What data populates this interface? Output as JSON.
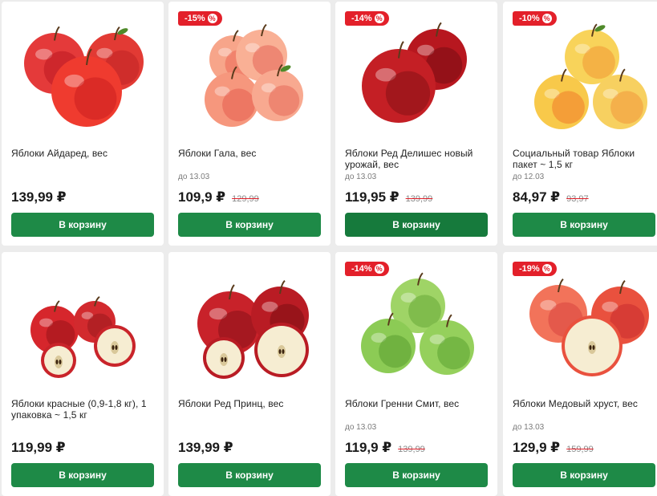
{
  "colors": {
    "accent_green": "#1e8a47",
    "discount_red": "#e3202a",
    "background": "#ececec"
  },
  "cart_button_label": "В корзину",
  "products": [
    {
      "title": "Яблоки Айдаред, вес",
      "discount": "",
      "until": "",
      "price": "139,99 ₽",
      "old_price": "",
      "icon": "apples-red-icon"
    },
    {
      "title": "Яблоки Гала, вес",
      "discount": "-15%",
      "until": "до 13.03",
      "price": "109,9 ₽",
      "old_price": "129,99",
      "icon": "apples-gala-icon"
    },
    {
      "title": "Яблоки Ред Делишес новый урожай, вес",
      "discount": "-14%",
      "until": "до 13.03",
      "price": "119,95 ₽",
      "old_price": "139,99",
      "icon": "apples-red-delicious-icon"
    },
    {
      "title": "Социальный товар Яблоки пакет ~ 1,5 кг",
      "discount": "-10%",
      "until": "до 12.03",
      "price": "84,97 ₽",
      "old_price": "93,97",
      "icon": "apples-yellow-icon"
    },
    {
      "title": "Яблоки красные (0,9-1,8 кг), 1 упаковка ~ 1,5 кг",
      "discount": "",
      "until": "",
      "price": "119,99 ₽",
      "old_price": "",
      "icon": "apples-red-cut-icon"
    },
    {
      "title": "Яблоки Ред Принц, вес",
      "discount": "",
      "until": "",
      "price": "139,99 ₽",
      "old_price": "",
      "icon": "apples-red-prince-icon"
    },
    {
      "title": "Яблоки Гренни Смит, вес",
      "discount": "-14%",
      "until": "до 13.03",
      "price": "119,9 ₽",
      "old_price": "139,99",
      "icon": "apples-green-icon"
    },
    {
      "title": "Яблоки Медовый хруст, вес",
      "discount": "-19%",
      "until": "до 13.03",
      "price": "129,9 ₽",
      "old_price": "159,99",
      "icon": "apples-honeycrisp-icon"
    }
  ]
}
